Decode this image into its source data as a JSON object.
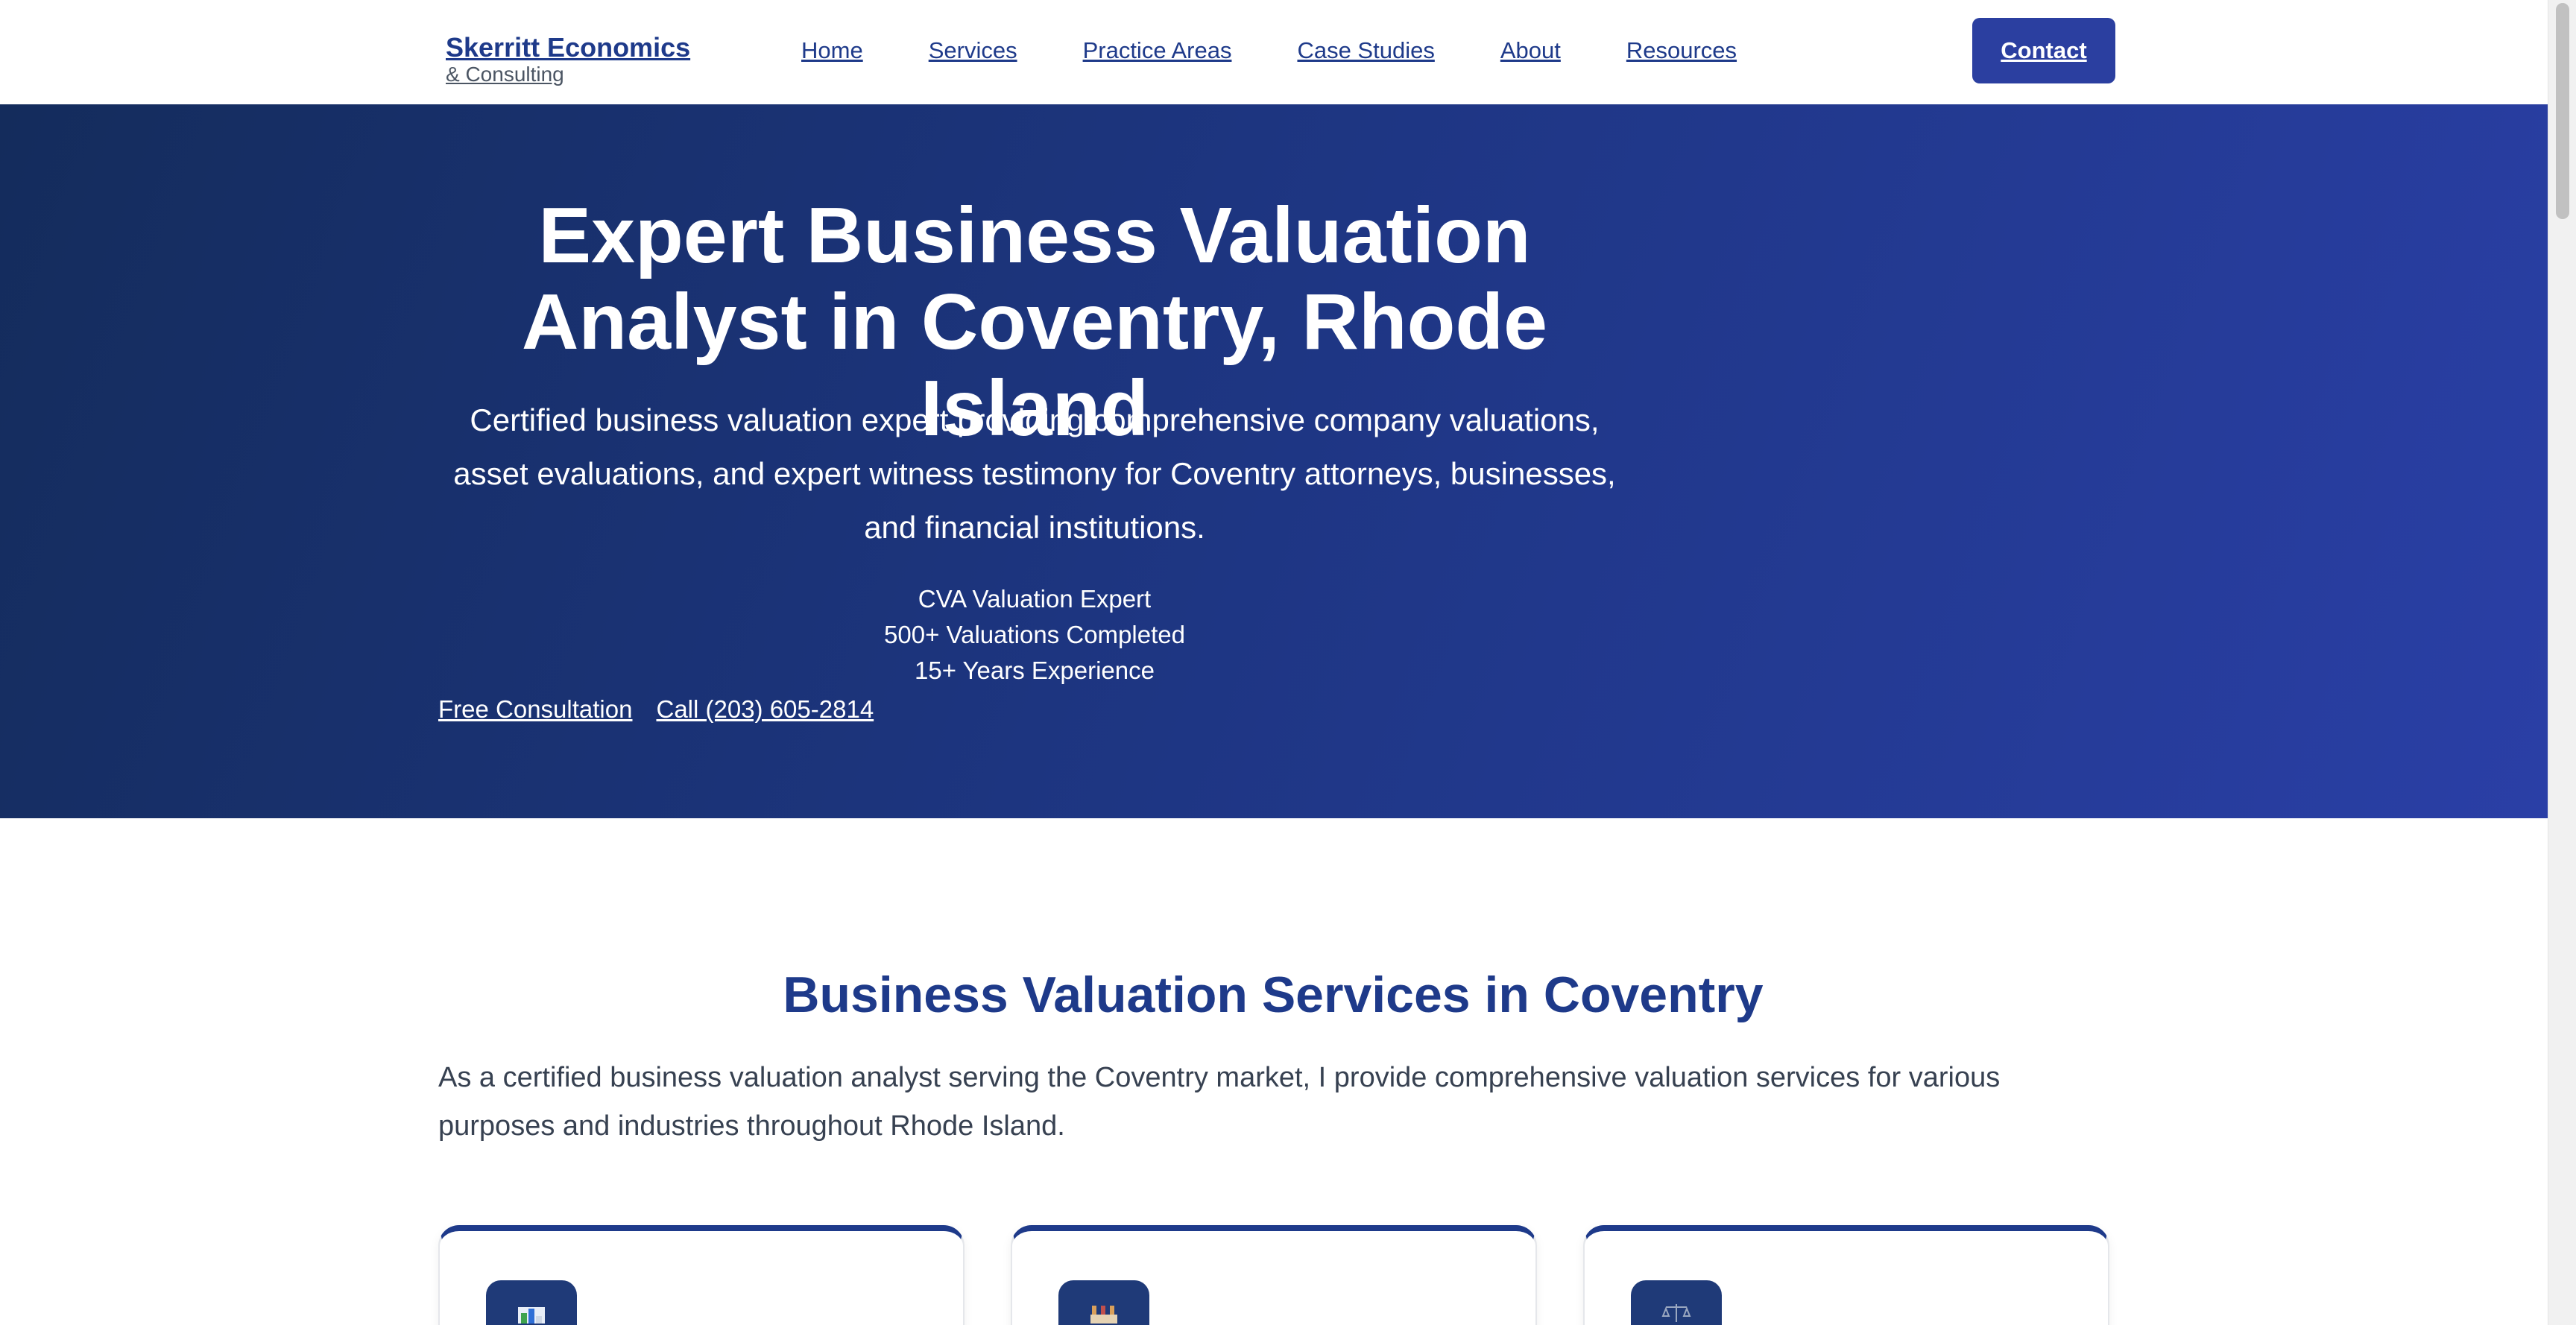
{
  "brand": {
    "name": "Skerritt Economics",
    "subtitle": "& Consulting"
  },
  "nav": {
    "items": [
      {
        "label": "Home"
      },
      {
        "label": "Services"
      },
      {
        "label": "Practice Areas"
      },
      {
        "label": "Case Studies"
      },
      {
        "label": "About"
      },
      {
        "label": "Resources"
      }
    ],
    "contact_label": "Contact"
  },
  "hero": {
    "title_line1": "Expert Business Valuation",
    "title_line2": "Analyst in Coventry, Rhode Island",
    "description": "Certified business valuation expert providing comprehensive company valuations, asset evaluations, and expert witness testimony for Coventry attorneys, businesses, and financial institutions.",
    "stats": [
      "CVA Valuation Expert",
      "500+ Valuations Completed",
      "15+ Years Experience"
    ],
    "cta_consultation": "Free Consultation",
    "cta_call": "Call (203) 605-2814"
  },
  "services": {
    "title": "Business Valuation Services in Coventry",
    "description": "As a certified business valuation analyst serving the Coventry market, I provide comprehensive valuation services for various purposes and industries throughout Rhode Island.",
    "cards": [
      {
        "icon": "bar-chart-icon"
      },
      {
        "icon": "factory-icon"
      },
      {
        "icon": "scales-icon"
      }
    ]
  },
  "colors": {
    "brand_blue": "#1e3a8a",
    "button_blue": "#2b3fa0",
    "hero_gradient_start": "#142c5c",
    "hero_gradient_end": "#2a3fa6"
  }
}
